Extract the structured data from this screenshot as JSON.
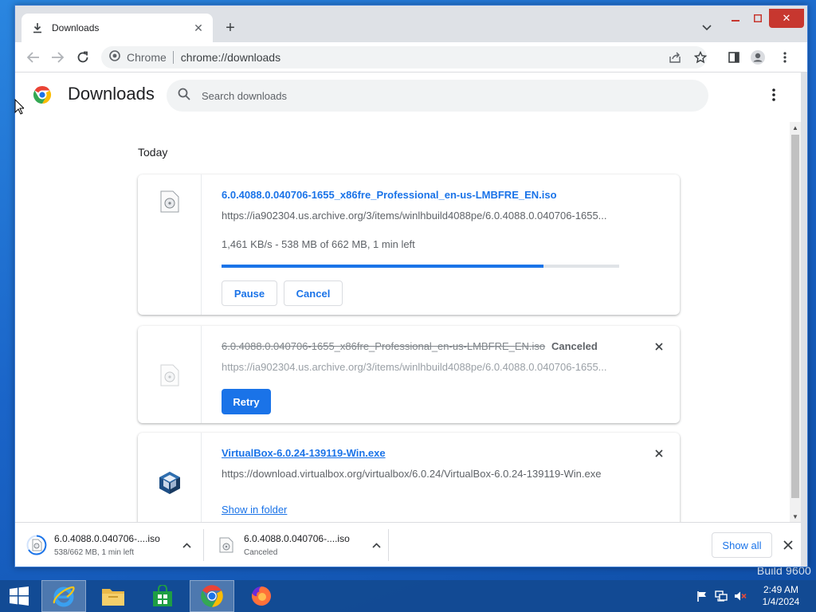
{
  "desktop": {
    "watermark": "Build 9600"
  },
  "browser": {
    "tab": {
      "title": "Downloads"
    },
    "omnibox": {
      "chrome_label": "Chrome",
      "url": "chrome://downloads"
    }
  },
  "page": {
    "title": "Downloads",
    "search": {
      "placeholder": "Search downloads",
      "value": ""
    },
    "section_label": "Today"
  },
  "downloads": [
    {
      "filename": "6.0.4088.0.040706-1655_x86fre_Professional_en-us-LMBFRE_EN.iso",
      "url": "https://ia902304.us.archive.org/3/items/winlhbuild4088pe/6.0.4088.0.040706-1655...",
      "status": "1,461 KB/s - 538 MB of 662 MB, 1 min left",
      "progress": 0.81,
      "pause_label": "Pause",
      "cancel_label": "Cancel"
    },
    {
      "filename": "6.0.4088.0.040706-1655_x86fre_Professional_en-us-LMBFRE_EN.iso",
      "url": "https://ia902304.us.archive.org/3/items/winlhbuild4088pe/6.0.4088.0.040706-1655...",
      "state": "Canceled",
      "retry_label": "Retry"
    },
    {
      "filename": "VirtualBox-6.0.24-139119-Win.exe",
      "url": "https://download.virtualbox.org/virtualbox/6.0.24/VirtualBox-6.0.24-139119-Win.exe",
      "show_in_folder_label": "Show in folder"
    }
  ],
  "shelf": {
    "items": [
      {
        "name": "6.0.4088.0.040706-....iso",
        "status": "538/662 MB, 1 min left"
      },
      {
        "name": "6.0.4088.0.040706-....iso",
        "status": "Canceled"
      }
    ],
    "show_all_label": "Show all"
  },
  "taskbar": {
    "clock": {
      "time": "2:49 AM",
      "date": "1/4/2024"
    }
  },
  "colors": {
    "accent": "#1a73e8",
    "window_close": "#c7372f",
    "taskbar": "#124a91"
  }
}
